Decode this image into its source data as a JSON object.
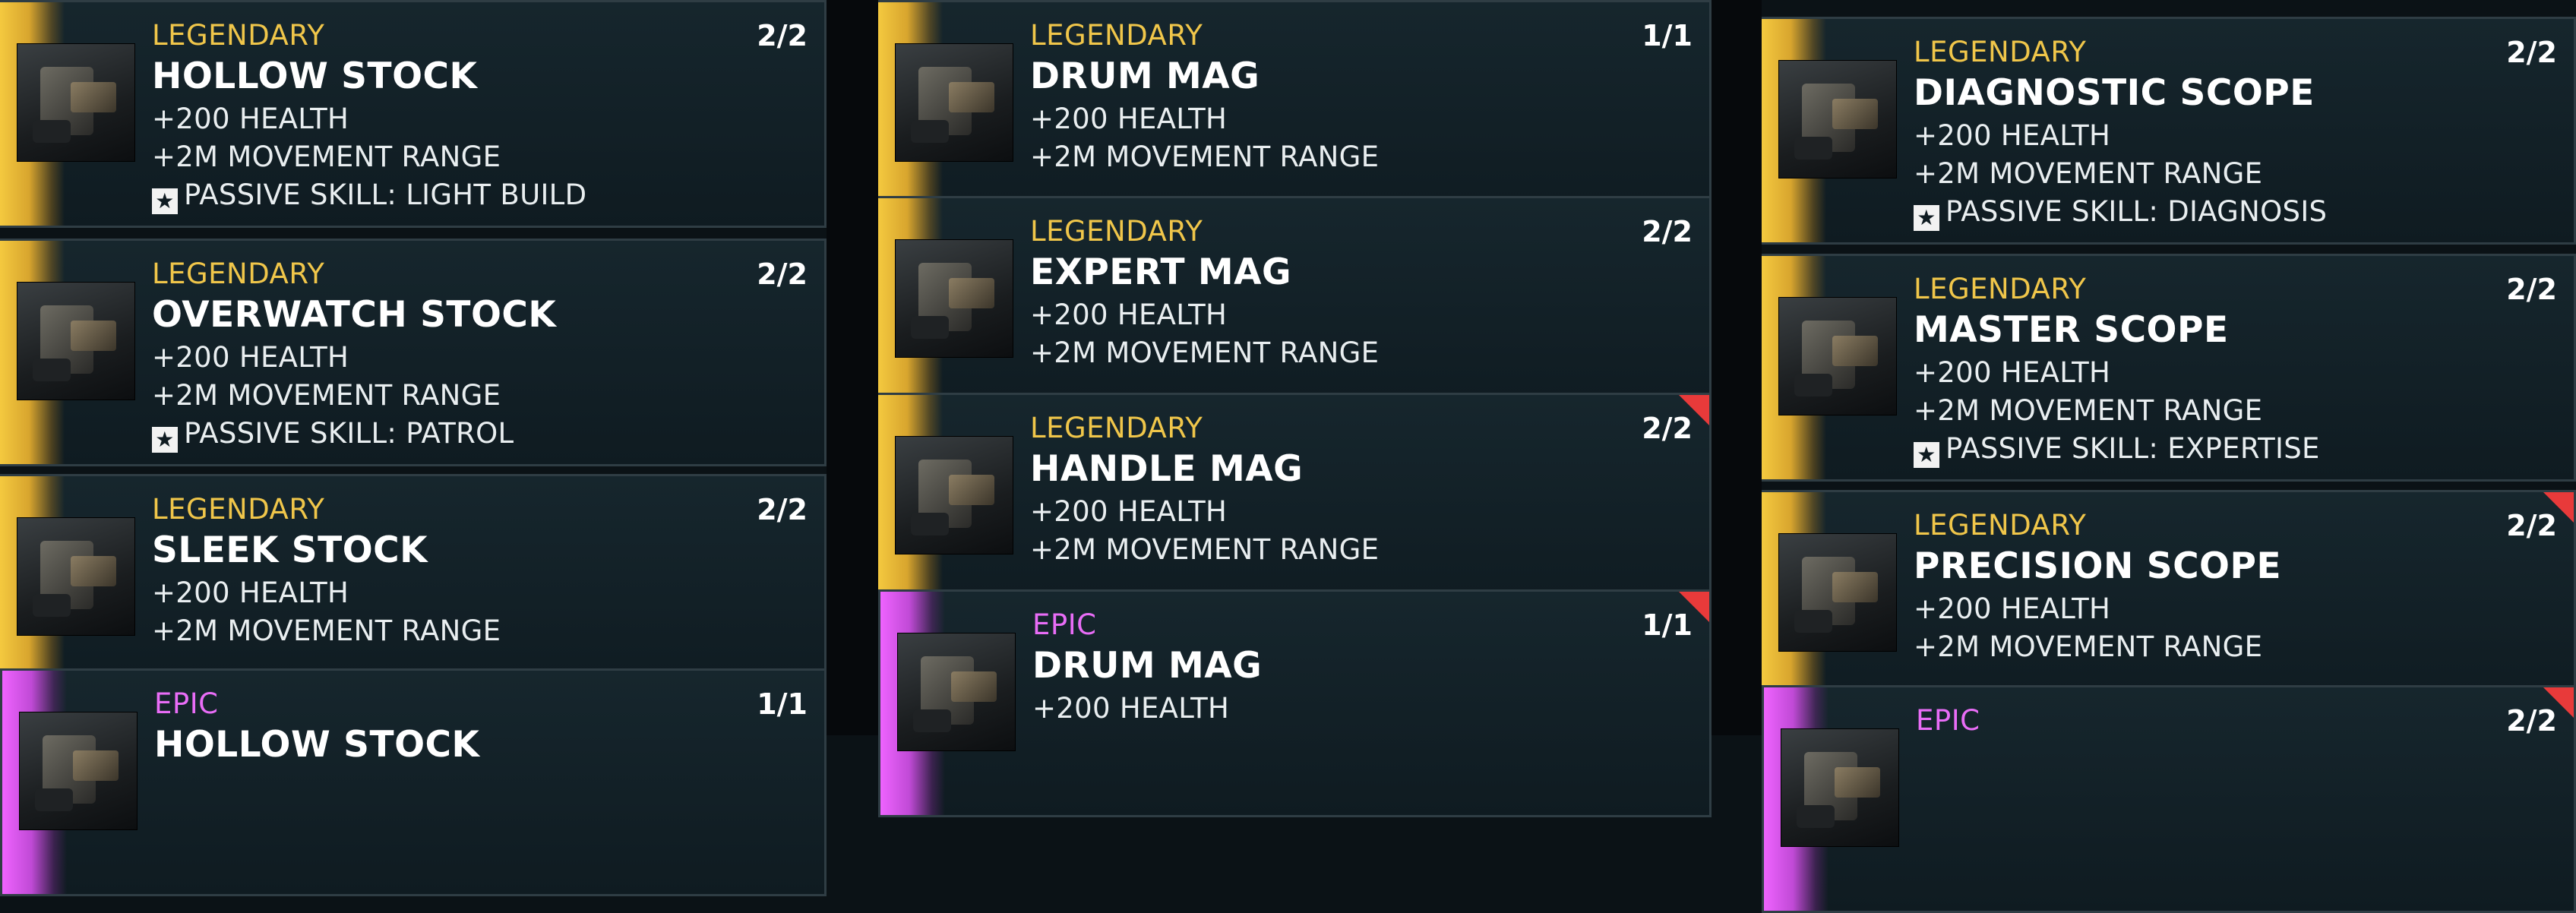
{
  "columns": [
    {
      "cards": [
        {
          "rarity": "LEGENDARY",
          "tier": "legendary",
          "name": "HOLLOW STOCK",
          "count": "2/2",
          "stats": [
            "+200 HEALTH",
            "+2M MOVEMENT RANGE"
          ],
          "skill": "PASSIVE SKILL: LIGHT BUILD",
          "new": false
        },
        {
          "rarity": "LEGENDARY",
          "tier": "legendary",
          "name": "OVERWATCH STOCK",
          "count": "2/2",
          "stats": [
            "+200 HEALTH",
            "+2M MOVEMENT RANGE"
          ],
          "skill": "PASSIVE SKILL: PATROL",
          "new": false
        },
        {
          "rarity": "LEGENDARY",
          "tier": "legendary",
          "name": "SLEEK STOCK",
          "count": "2/2",
          "stats": [
            "+200 HEALTH",
            "+2M MOVEMENT RANGE"
          ],
          "skill": "",
          "new": false
        },
        {
          "rarity": "EPIC",
          "tier": "epic",
          "name": "HOLLOW STOCK",
          "count": "1/1",
          "stats": [],
          "skill": "",
          "new": false
        }
      ]
    },
    {
      "cards": [
        {
          "rarity": "LEGENDARY",
          "tier": "legendary",
          "name": "DRUM MAG",
          "count": "1/1",
          "stats": [
            "+200 HEALTH",
            "+2M MOVEMENT RANGE"
          ],
          "skill": "",
          "new": false
        },
        {
          "rarity": "LEGENDARY",
          "tier": "legendary",
          "name": "EXPERT MAG",
          "count": "2/2",
          "stats": [
            "+200 HEALTH",
            "+2M MOVEMENT RANGE"
          ],
          "skill": "",
          "new": false
        },
        {
          "rarity": "LEGENDARY",
          "tier": "legendary",
          "name": "HANDLE MAG",
          "count": "2/2",
          "stats": [
            "+200 HEALTH",
            "+2M MOVEMENT RANGE"
          ],
          "skill": "",
          "new": true
        },
        {
          "rarity": "EPIC",
          "tier": "epic",
          "name": "DRUM MAG",
          "count": "1/1",
          "stats": [
            "+200 HEALTH"
          ],
          "skill": "",
          "new": true
        }
      ]
    },
    {
      "cards": [
        {
          "rarity": "LEGENDARY",
          "tier": "legendary",
          "name": "DIAGNOSTIC SCOPE",
          "count": "2/2",
          "stats": [
            "+200 HEALTH",
            "+2M MOVEMENT RANGE"
          ],
          "skill": "PASSIVE SKILL: DIAGNOSIS",
          "new": false
        },
        {
          "rarity": "LEGENDARY",
          "tier": "legendary",
          "name": "MASTER SCOPE",
          "count": "2/2",
          "stats": [
            "+200 HEALTH",
            "+2M MOVEMENT RANGE"
          ],
          "skill": "PASSIVE SKILL: EXPERTISE",
          "new": false
        },
        {
          "rarity": "LEGENDARY",
          "tier": "legendary",
          "name": "PRECISION SCOPE",
          "count": "2/2",
          "stats": [
            "+200 HEALTH",
            "+2M MOVEMENT RANGE"
          ],
          "skill": "",
          "new": true
        },
        {
          "rarity": "EPIC",
          "tier": "epic",
          "name": "",
          "count": "2/2",
          "stats": [],
          "skill": "",
          "new": true
        }
      ]
    }
  ],
  "icons": {
    "skill": "star-badge-icon",
    "thumb": "weapon-part-icon",
    "new": "new-item-flag-icon"
  },
  "colors": {
    "legendary": "#f0c64a",
    "epic": "#e96df7",
    "new_flag": "#e83a3a",
    "card_bg": "#12222a"
  }
}
